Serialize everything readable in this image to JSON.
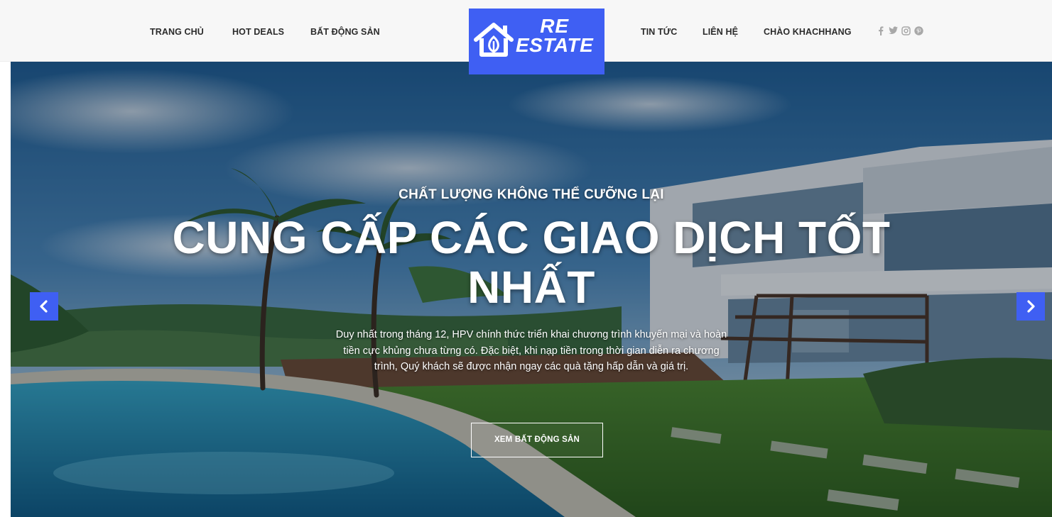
{
  "nav": {
    "left": [
      "TRANG CHỦ",
      "HOT DEALS",
      "BẤT ĐỘNG SẢN"
    ],
    "right": [
      "TIN TỨC",
      "LIÊN HỆ",
      "CHÀO KHACHHANG"
    ]
  },
  "logo": {
    "line1": "RE",
    "line2": "ESTATE",
    "icon": "house-leaf-icon"
  },
  "social": [
    "facebook-icon",
    "twitter-icon",
    "instagram-icon",
    "pinterest-icon"
  ],
  "hero": {
    "subtitle": "CHẤT LƯỢNG KHÔNG THỂ CƯỠNG LẠI",
    "title": "CUNG CẤP CÁC GIAO DỊCH TỐT NHẤT",
    "description": "Duy nhất trong tháng 12, HPV chính thức triển khai chương trình khuyến mại và hoàn tiền cực khủng chưa từng có. Đặc biệt, khi nạp tiền trong thời gian diễn ra chương trình, Quý khách sẽ được nhận ngay các quà tặng hấp dẫn và giá trị.",
    "button": "XEM BẤT ĐỘNG SẢN"
  },
  "colors": {
    "accent": "#3f5ff3",
    "header_bg": "#f7f7f7",
    "nav_text": "#2b2b2b",
    "social_icon": "#a8a8a8"
  }
}
